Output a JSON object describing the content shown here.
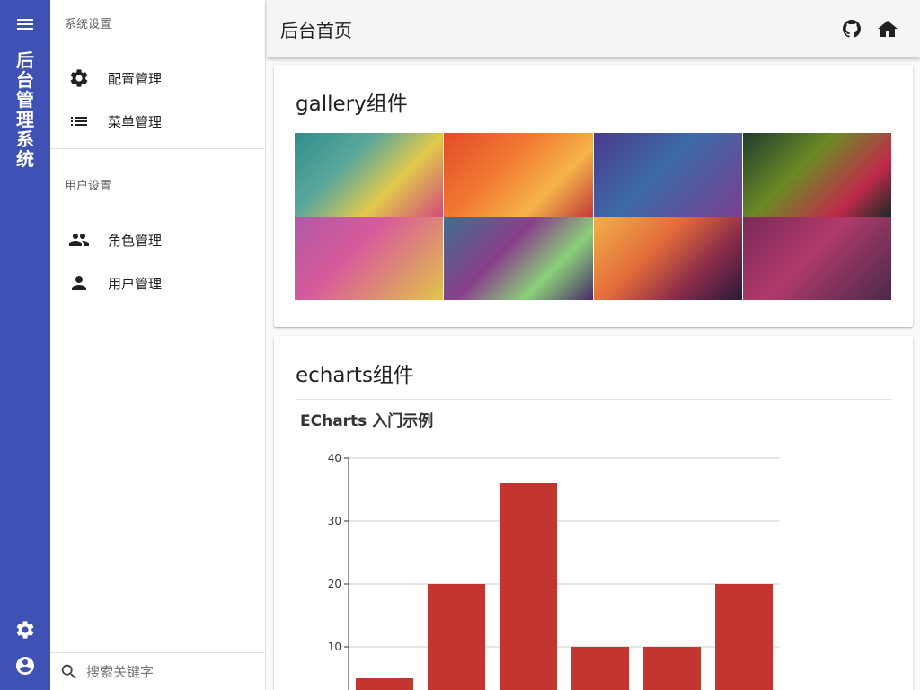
{
  "rail": {
    "brand_chars": [
      "后",
      "台",
      "管",
      "理",
      "系",
      "统"
    ]
  },
  "nav": {
    "section1_header": "系统设置",
    "section1_items": [
      "配置管理",
      "菜单管理"
    ],
    "section2_header": "用户设置",
    "section2_items": [
      "角色管理",
      "用户管理"
    ],
    "search_placeholder": "搜索关键字"
  },
  "topbar": {
    "title": "后台首页"
  },
  "gallery_card": {
    "title": "gallery组件",
    "tiles": [
      "linear-gradient(135deg,#2f8f8c 0%,#5aa79b 35%,#e2c84c 65%,#d14b7b 100%)",
      "linear-gradient(135deg,#e34b2a 0%,#f27a32 40%,#f5b44a 70%,#c23a3a 100%)",
      "linear-gradient(135deg,#4a3a8c 0%,#3d6aa8 45%,#7a3f8f 100%)",
      "linear-gradient(135deg,#1e3d2e 0%,#6c8a24 40%,#c02a4a 75%,#1a2a26 100%)",
      "linear-gradient(135deg,#b05aa8 0%,#d85a9a 40%,#e2c44a 100%)",
      "linear-gradient(135deg,#3f6f8f 0%,#8a3f8a 40%,#8ad07a 70%,#4a2a6a 100%)",
      "linear-gradient(135deg,#f2b04a 0%,#e26a3a 40%,#8a2a4a 70%,#2a1a3a 100%)",
      "linear-gradient(135deg,#7a2a5a 0%,#b03a6a 45%,#4a2a4a 100%)"
    ]
  },
  "echarts_card": {
    "title": "echarts组件",
    "bar_color": "#c23531"
  },
  "chart_data": {
    "type": "bar",
    "title": "ECharts 入门示例",
    "categories": [
      "",
      "",
      "",
      "",
      "",
      ""
    ],
    "values": [
      5,
      20,
      36,
      10,
      10,
      20
    ],
    "yticks": [
      "40",
      "30",
      "20",
      "10"
    ],
    "ylim": [
      0,
      40
    ],
    "grid": true
  }
}
